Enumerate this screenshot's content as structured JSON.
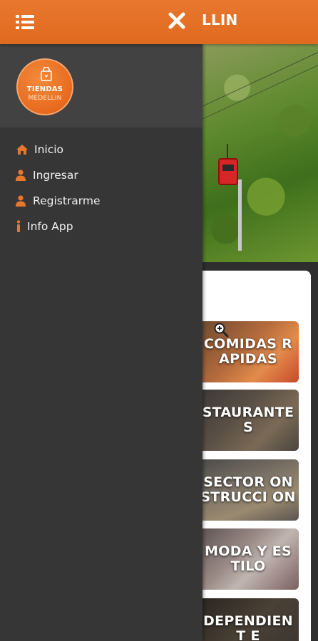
{
  "app": {
    "title": "LLIN",
    "accent_color": "#e8772e"
  },
  "logo": {
    "line1": "TIENDAS",
    "line2": "MEDELLIN"
  },
  "drawer": {
    "items": [
      {
        "label": "Inicio",
        "icon": "home-icon"
      },
      {
        "label": "Ingresar",
        "icon": "user-icon"
      },
      {
        "label": "Registrarme",
        "icon": "user-icon"
      },
      {
        "label": "Info App",
        "icon": "info-icon"
      }
    ]
  },
  "categories": [
    {
      "label": "COMIDAS RAPIDAS"
    },
    {
      "label": "STAURANTE S"
    },
    {
      "label": "SECTOR ONSTRUCCI ON"
    },
    {
      "label": "MODA Y ESTILO"
    },
    {
      "label": "DEPENDIENT E"
    }
  ]
}
